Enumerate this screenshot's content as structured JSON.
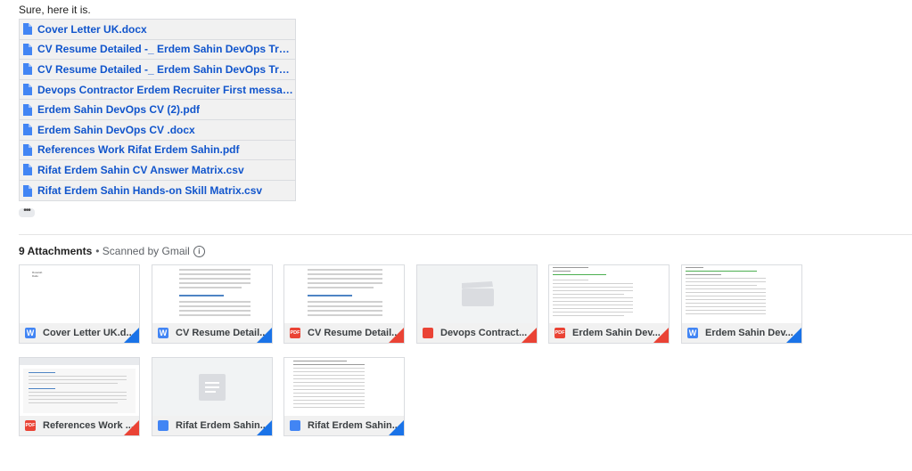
{
  "message": {
    "intro": "Sure, here it is."
  },
  "files": [
    {
      "name": "Cover Letter UK.docx"
    },
    {
      "name": "CV Resume Detailed -_ Erdem Sahin DevOps Transf..."
    },
    {
      "name": "CV Resume Detailed -_ Erdem Sahin DevOps Transf..."
    },
    {
      "name": "Devops Contractor Erdem Recruiter First message..."
    },
    {
      "name": "Erdem Sahin DevOps CV (2).pdf"
    },
    {
      "name": "Erdem Sahin DevOps CV .docx"
    },
    {
      "name": "References Work Rifat Erdem Sahin.pdf"
    },
    {
      "name": "Rifat Erdem Sahin CV Answer Matrix.csv"
    },
    {
      "name": "Rifat Erdem Sahin Hands-on Skill Matrix.csv"
    }
  ],
  "more_button": "•••",
  "attachments": {
    "count_label": "9 Attachments",
    "scanned_label": "• Scanned by Gmail",
    "info_icon_glyph": "i",
    "items": [
      {
        "name": "Cover Letter UK.d...",
        "type_label": "W",
        "icon": "word-icon",
        "thumb_text": [
          "Rusarab",
          "Dalto"
        ]
      },
      {
        "name": "CV Resume Detail...",
        "type_label": "W",
        "icon": "word-icon"
      },
      {
        "name": "CV Resume Detail...",
        "type_label": "PDF",
        "icon": "pdf-icon"
      },
      {
        "name": "Devops Contract...",
        "type_label": "",
        "icon": "video-icon"
      },
      {
        "name": "Erdem Sahin Dev...",
        "type_label": "PDF",
        "icon": "pdf-icon"
      },
      {
        "name": "Erdem Sahin Dev...",
        "type_label": "W",
        "icon": "word-icon"
      },
      {
        "name": "References Work ...",
        "type_label": "PDF",
        "icon": "pdf-icon"
      },
      {
        "name": "Rifat Erdem Sahin...",
        "type_label": "",
        "icon": "google-doc-icon"
      },
      {
        "name": "Rifat Erdem Sahin...",
        "type_label": "",
        "icon": "google-doc-icon"
      }
    ]
  },
  "colors": {
    "link": "#1155cc",
    "word": "#4285f4",
    "pdf": "#ea4335",
    "corner_blue": "#1a73e8",
    "corner_red": "#ea4335"
  }
}
